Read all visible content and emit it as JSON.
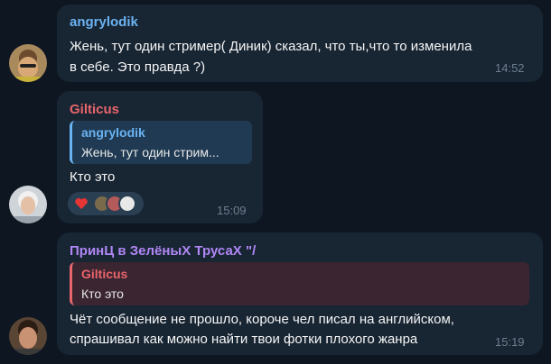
{
  "colors": {
    "background": "#0e1621",
    "bubble": "#182533",
    "name_blue": "#6ab3f3",
    "name_red": "#e8656b",
    "name_purple": "#b087f5",
    "time": "#6d7f8f"
  },
  "messages": [
    {
      "sender": "angrylodik",
      "line1": "Жень, тут один стример( Диник) сказал, что ты,что то  изменила",
      "line2": "в себе. Это правда ?)",
      "time": "14:52"
    },
    {
      "sender": "Gilticus",
      "reply_name": "angrylodik",
      "reply_text": "Жень, тут один стрим...",
      "text": "Кто это",
      "reaction_icon": "heart-icon",
      "time": "15:09"
    },
    {
      "sender": "ПринЦ в ЗелёныХ ТрусаХ \"/",
      "reply_name": "Gilticus",
      "reply_text": "Кто это",
      "line1": "Чёт сообщение не прошло, короче чел писал на английском,",
      "line2": "спрашивал как можно найти твои фотки плохого жанра",
      "time": "15:19"
    }
  ]
}
